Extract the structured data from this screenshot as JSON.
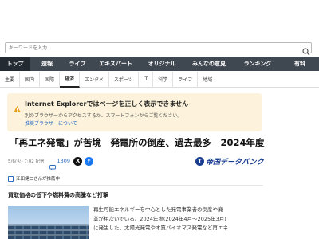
{
  "search": {
    "placeholder": "キーワードを入力"
  },
  "nav_primary": [
    {
      "label": "トップ",
      "active": true
    },
    {
      "label": "速報",
      "active": false
    },
    {
      "label": "ライブ",
      "active": false
    },
    {
      "label": "エキスパート",
      "active": false
    },
    {
      "label": "オリジナル",
      "active": false
    },
    {
      "label": "みんなの意見",
      "active": false
    },
    {
      "label": "ランキング",
      "active": false
    },
    {
      "label": "有料",
      "active": false
    }
  ],
  "nav_secondary": [
    {
      "label": "主要",
      "active": false
    },
    {
      "label": "国内",
      "active": false
    },
    {
      "label": "国際",
      "active": false
    },
    {
      "label": "経済",
      "active": true
    },
    {
      "label": "エンタメ",
      "active": false
    },
    {
      "label": "スポーツ",
      "active": false
    },
    {
      "label": "IT",
      "active": false
    },
    {
      "label": "科学",
      "active": false
    },
    {
      "label": "ライフ",
      "active": false
    },
    {
      "label": "地域",
      "active": false
    }
  ],
  "ie_warning": {
    "title": "Internet Explorerではページを正しく表示できません",
    "body": "別のブラウザーからアクセスするか、スマートフォンからご覧ください。",
    "link": "推奨ブラウザーについて"
  },
  "article": {
    "headline": "「再エネ発電」が苦境　発電所の倒産、過去最多　2024年度",
    "date": "5/6(火) 7:02 配信",
    "comment_count": "1309",
    "source_logo": "帝国データバンク",
    "expert_text": "江田健二さんが推薦中",
    "subheading": "買取価格の低下や燃料費の高騰など打撃",
    "body_lines": [
      "再生可能エネルギーを中心とした発電事業者の倒産や廃",
      "業が相次いでいる。2024年度(2024年4月～2025年3月)",
      "に発生した、太陽光発電や木質バイオマス発電など再エネ"
    ]
  },
  "colors": {
    "nav_bg": "#3f4750",
    "nav_active": "#232a31",
    "warning_bg": "#fdf3dc",
    "link": "#2a6bbf",
    "logo": "#1a3d8f"
  }
}
